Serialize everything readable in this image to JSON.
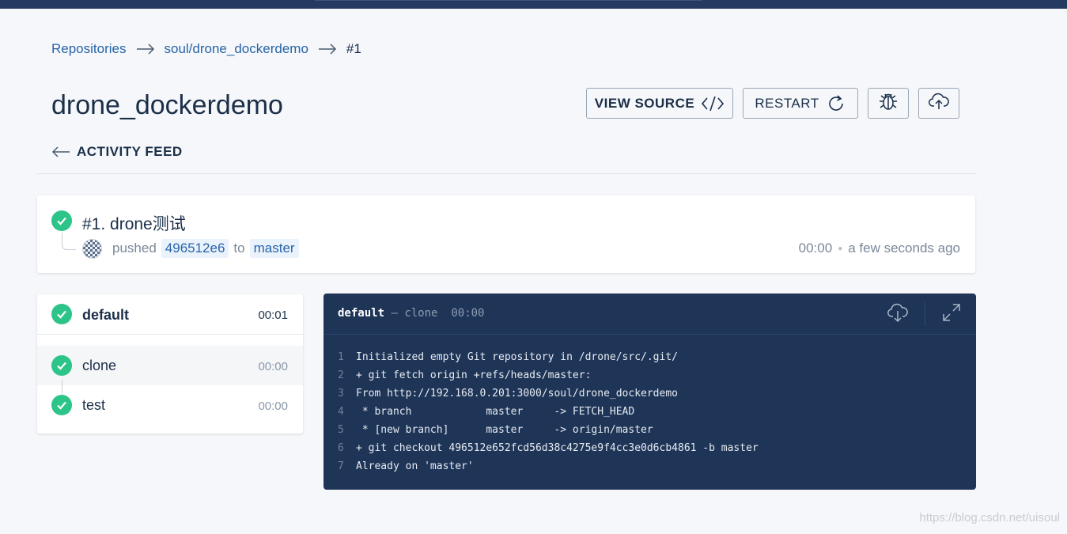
{
  "breadcrumb": {
    "items": [
      "Repositories",
      "soul/drone_dockerdemo"
    ],
    "current": "#1"
  },
  "repo": {
    "title": "drone_dockerdemo"
  },
  "actions": {
    "view_source": "VIEW SOURCE",
    "restart": "RESTART"
  },
  "activity_feed": "ACTIVITY FEED",
  "build": {
    "title": "#1. drone测试",
    "action": "pushed",
    "commit": "496512e6",
    "to": "to",
    "branch": "master",
    "duration": "00:00",
    "when": "a few seconds ago",
    "status_color": "#2dc489"
  },
  "stage": {
    "name": "default",
    "duration": "00:01",
    "steps": [
      {
        "name": "clone",
        "duration": "00:00"
      },
      {
        "name": "test",
        "duration": "00:00"
      }
    ]
  },
  "console": {
    "stage": "default",
    "dash": "—",
    "step": "clone",
    "duration": "00:00",
    "lines": [
      {
        "num": "1",
        "text": "Initialized empty Git repository in /drone/src/.git/"
      },
      {
        "num": "2",
        "text": "+ git fetch origin +refs/heads/master:"
      },
      {
        "num": "3",
        "text": "From http://192.168.0.201:3000/soul/drone_dockerdemo"
      },
      {
        "num": "4",
        "text": " * branch            master     -> FETCH_HEAD"
      },
      {
        "num": "5",
        "text": " * [new branch]      master     -> origin/master"
      },
      {
        "num": "6",
        "text": "+ git checkout 496512e652fcd56d38c4275e9f4cc3e0d6cb4861 -b master"
      },
      {
        "num": "7",
        "text": "Already on 'master'"
      }
    ]
  },
  "watermark": "https://blog.csdn.net/uisoul",
  "icons": {
    "view_source": "code-icon",
    "restart": "refresh-icon",
    "debug": "bug-icon",
    "deploy": "cloud-upload-icon",
    "download": "cloud-download-icon",
    "expand": "expand-icon",
    "back": "arrow-left-icon"
  }
}
